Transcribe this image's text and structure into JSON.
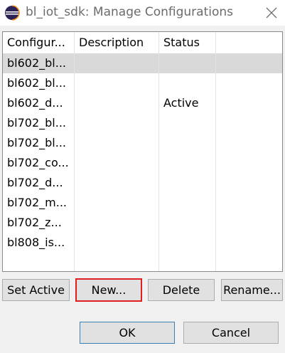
{
  "window": {
    "title": "bl_iot_sdk: Manage Configurations"
  },
  "icons": {
    "app": "eclipse-icon",
    "close": "close-icon"
  },
  "table": {
    "columns": [
      "Configur...",
      "Description",
      "Status",
      ""
    ],
    "rows": [
      {
        "name": "bl602_bl...",
        "description": "",
        "status": "",
        "selected": true
      },
      {
        "name": "bl602_bl...",
        "description": "",
        "status": ""
      },
      {
        "name": "bl602_d...",
        "description": "",
        "status": "Active"
      },
      {
        "name": "bl702_bl...",
        "description": "",
        "status": ""
      },
      {
        "name": "bl702_bl...",
        "description": "",
        "status": ""
      },
      {
        "name": "bl702_co...",
        "description": "",
        "status": ""
      },
      {
        "name": "bl702_d...",
        "description": "",
        "status": ""
      },
      {
        "name": "bl702_m...",
        "description": "",
        "status": ""
      },
      {
        "name": "bl702_z...",
        "description": "",
        "status": ""
      },
      {
        "name": "bl808_is...",
        "description": "",
        "status": ""
      },
      {
        "name": "",
        "description": "",
        "status": ""
      }
    ]
  },
  "buttons": {
    "set_active": "Set Active",
    "new": "New...",
    "delete": "Delete",
    "rename": "Rename...",
    "ok": "OK",
    "cancel": "Cancel"
  },
  "colors": {
    "highlight_border": "#e02020",
    "selected_row": "#d9d9d9",
    "default_button_border": "#3c7fb1"
  }
}
